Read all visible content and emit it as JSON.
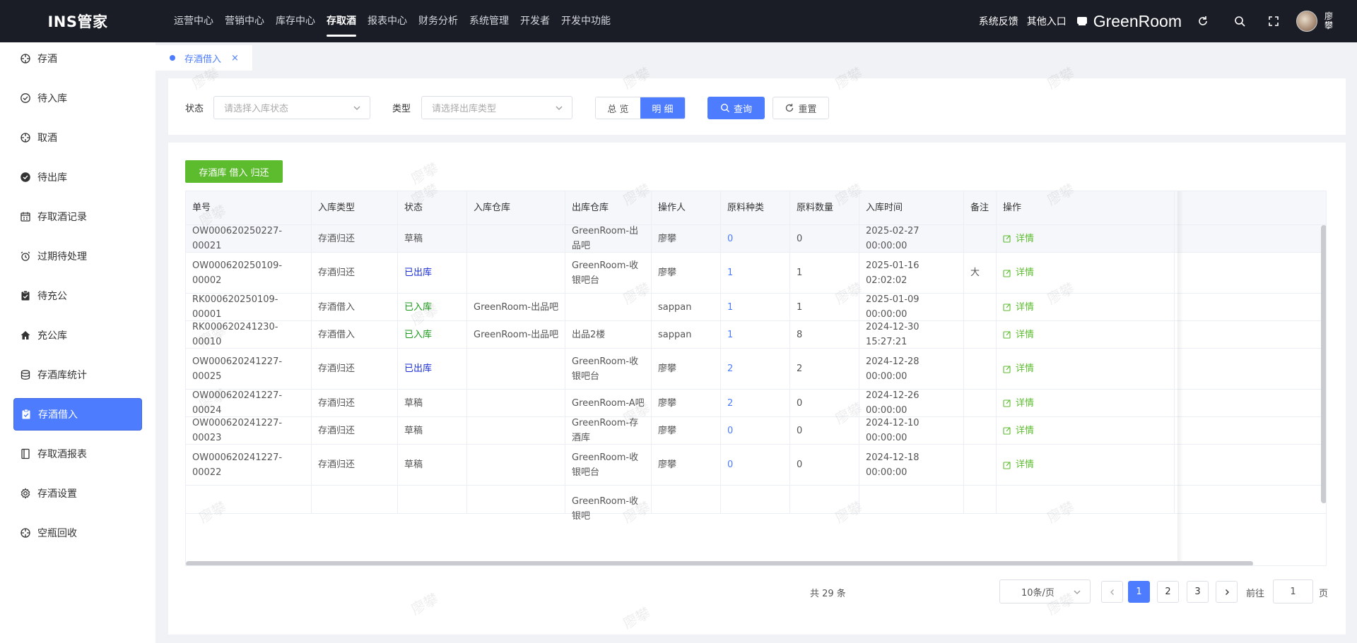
{
  "brand": {
    "logo": "INS管家"
  },
  "topnav": {
    "items": [
      "运营中心",
      "营销中心",
      "库存中心",
      "存取酒",
      "报表中心",
      "财务分析",
      "系统管理",
      "开发者",
      "开发中功能"
    ],
    "active_index": 3
  },
  "header": {
    "feedback": "系统反馈",
    "other_entry": "其他入口",
    "store_name": "GreenRoom",
    "user_name": "廖攀"
  },
  "sidebar": {
    "items": [
      {
        "label": "存酒",
        "icon": "crosshair-icon"
      },
      {
        "label": "待入库",
        "icon": "check-circle-icon"
      },
      {
        "label": "取酒",
        "icon": "crosshair-icon"
      },
      {
        "label": "待出库",
        "icon": "check-circle-filled-icon"
      },
      {
        "label": "存取酒记录",
        "icon": "calendar-icon"
      },
      {
        "label": "过期待处理",
        "icon": "alarm-icon"
      },
      {
        "label": "待充公",
        "icon": "clipboard-check-icon"
      },
      {
        "label": "充公库",
        "icon": "home-icon"
      },
      {
        "label": "存酒库统计",
        "icon": "database-icon"
      },
      {
        "label": "存酒借入",
        "icon": "clipboard-check-icon"
      },
      {
        "label": "存取酒报表",
        "icon": "book-icon"
      },
      {
        "label": "存酒设置",
        "icon": "gear-icon"
      },
      {
        "label": "空瓶回收",
        "icon": "crosshair-icon"
      }
    ],
    "active_index": 9
  },
  "tabs": [
    {
      "label": "存酒借入",
      "close": "×"
    }
  ],
  "filter": {
    "status_label": "状态",
    "status_placeholder": "请选择入库状态",
    "type_label": "类型",
    "type_placeholder": "请选择出库类型",
    "view_overview": "总 览",
    "view_detail": "明 细",
    "query": "查询",
    "reset": "重置"
  },
  "actions": {
    "borrow_return": "存酒库 借入 归还"
  },
  "table": {
    "columns": [
      "单号",
      "入库类型",
      "状态",
      "入库仓库",
      "出库仓库",
      "操作人",
      "原料种类",
      "原料数量",
      "入库时间",
      "备注",
      "操作"
    ],
    "rows": [
      {
        "no": "OW000620250227-00021",
        "type": "存酒归还",
        "status": "草稿",
        "in_wh": "",
        "out_wh": "GreenRoom-出品吧",
        "operator": "廖攀",
        "kinds": "0",
        "qty": "0",
        "time": "2025-02-27 00:00:00",
        "remark": "",
        "op": "详情"
      },
      {
        "no": "OW000620250109-00002",
        "type": "存酒归还",
        "status": "已出库",
        "in_wh": "",
        "out_wh": "GreenRoom-收银吧台",
        "operator": "廖攀",
        "kinds": "1",
        "qty": "1",
        "time": "2025-01-16 02:02:02",
        "remark": "大",
        "op": "详情"
      },
      {
        "no": "RK000620250109-00001",
        "type": "存酒借入",
        "status": "已入库",
        "in_wh": "GreenRoom-出品吧",
        "out_wh": "",
        "operator": "sappan",
        "kinds": "1",
        "qty": "1",
        "time": "2025-01-09 00:00:00",
        "remark": "",
        "op": "详情"
      },
      {
        "no": "RK000620241230-00010",
        "type": "存酒借入",
        "status": "已入库",
        "in_wh": "GreenRoom-出品吧",
        "out_wh": "出品2楼",
        "operator": "sappan",
        "kinds": "1",
        "qty": "8",
        "time": "2024-12-30 15:27:21",
        "remark": "",
        "op": "详情"
      },
      {
        "no": "OW000620241227-00025",
        "type": "存酒归还",
        "status": "已出库",
        "in_wh": "",
        "out_wh": "GreenRoom-收银吧台",
        "operator": "廖攀",
        "kinds": "2",
        "qty": "2",
        "time": "2024-12-28 00:00:00",
        "remark": "",
        "op": "详情"
      },
      {
        "no": "OW000620241227-00024",
        "type": "存酒归还",
        "status": "草稿",
        "in_wh": "",
        "out_wh": "GreenRoom-A吧",
        "operator": "廖攀",
        "kinds": "2",
        "qty": "0",
        "time": "2024-12-26 00:00:00",
        "remark": "",
        "op": "详情"
      },
      {
        "no": "OW000620241227-00023",
        "type": "存酒归还",
        "status": "草稿",
        "in_wh": "",
        "out_wh": "GreenRoom-存酒库",
        "operator": "廖攀",
        "kinds": "0",
        "qty": "0",
        "time": "2024-12-10 00:00:00",
        "remark": "",
        "op": "详情"
      },
      {
        "no": "OW000620241227-00022",
        "type": "存酒归还",
        "status": "草稿",
        "in_wh": "",
        "out_wh": "GreenRoom-收银吧台",
        "operator": "廖攀",
        "kinds": "0",
        "qty": "0",
        "time": "2024-12-18 00:00:00",
        "remark": "",
        "op": "详情"
      },
      {
        "no": "",
        "type": "",
        "status": "",
        "in_wh": "",
        "out_wh": "GreenRoom-收银吧",
        "operator": "",
        "kinds": "",
        "qty": "",
        "time": "",
        "remark": "",
        "op": ""
      }
    ]
  },
  "pagination": {
    "total": "共 29 条",
    "page_size": "10条/页",
    "pages": [
      "1",
      "2",
      "3"
    ],
    "current": "1",
    "goto_label": "前往",
    "goto_value": "1",
    "page_suffix": "页"
  },
  "watermark": "廖攀",
  "colors": {
    "primary": "#4d7cfe",
    "success_button": "#5cbc2e",
    "topbar": "#1a1d26",
    "status_outbound": "#1b2fd6",
    "status_inbound": "#1a9a1a"
  }
}
